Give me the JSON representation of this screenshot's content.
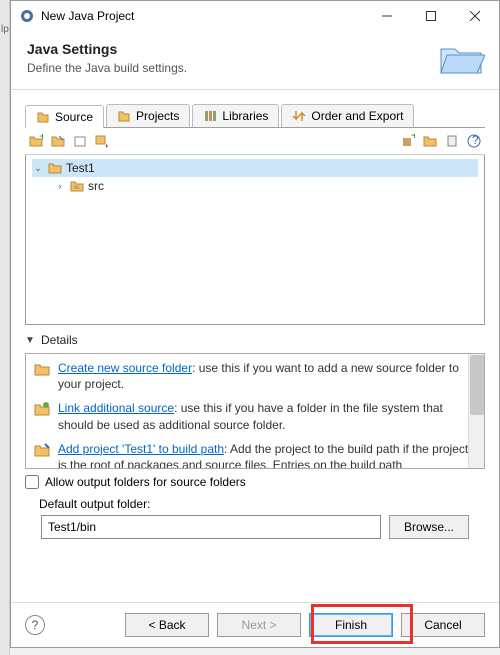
{
  "window": {
    "title": "New Java Project"
  },
  "header": {
    "title": "Java Settings",
    "subtitle": "Define the Java build settings."
  },
  "tabs": [
    {
      "label": "Source",
      "active": true
    },
    {
      "label": "Projects",
      "active": false
    },
    {
      "label": "Libraries",
      "active": false
    },
    {
      "label": "Order and Export",
      "active": false
    }
  ],
  "tree": {
    "root": {
      "label": "Test1",
      "expanded": true
    },
    "children": [
      {
        "label": "src",
        "expanded": false
      }
    ]
  },
  "details": {
    "title": "Details",
    "items": [
      {
        "link": "Create new source folder",
        "rest": ": use this if you want to add a new source folder to your project."
      },
      {
        "link": "Link additional source",
        "rest": ": use this if you have a folder in the file system that should be used as additional source folder."
      },
      {
        "link": "Add project 'Test1' to build path",
        "rest": ": Add the project to the build path if the project is the root of packages and source files. Entries on the build path"
      }
    ]
  },
  "allowOutput": {
    "label": "Allow output folders for source folders",
    "checked": false
  },
  "output": {
    "label": "Default output folder:",
    "value": "Test1/bin",
    "browse": "Browse..."
  },
  "buttons": {
    "back": "< Back",
    "next": "Next >",
    "finish": "Finish",
    "cancel": "Cancel"
  }
}
